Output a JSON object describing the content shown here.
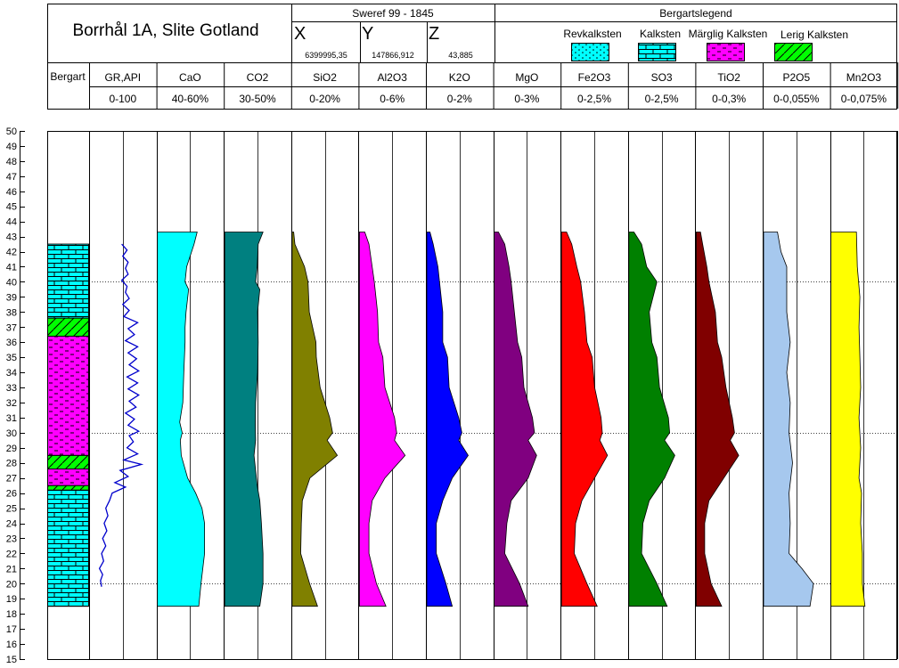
{
  "header": {
    "title": "Borrhål 1A, Slite Gotland",
    "coord_title": "Sweref 99 - 1845",
    "x_label": "X",
    "x_value": "6399995,35",
    "y_label": "Y",
    "y_value": "147866,912",
    "z_label": "Z",
    "z_value": "43,885",
    "legend_title": "Bergartslegend",
    "legend_items": [
      {
        "label": "Revkalksten",
        "color": "#00ffff",
        "pattern": "dots"
      },
      {
        "label": "Kalksten",
        "color": "#00ffff",
        "pattern": "brick"
      },
      {
        "label": "Märglig Kalksten",
        "color": "#ff00ff",
        "pattern": "dash"
      },
      {
        "label": "Lerig Kalksten",
        "color": "#00ff00",
        "pattern": "diag"
      }
    ],
    "bergart_label": "Bergart"
  },
  "chart_data": {
    "type": "area",
    "depth_axis": {
      "min": 15,
      "max": 50,
      "step": 1,
      "ticks": [
        "15",
        "16",
        "17",
        "18",
        "19",
        "20",
        "21",
        "22",
        "23",
        "24",
        "25",
        "26",
        "27",
        "28",
        "29",
        "30",
        "31",
        "32",
        "33",
        "34",
        "35",
        "36",
        "37",
        "38",
        "39",
        "40",
        "41",
        "42",
        "43",
        "44",
        "45",
        "46",
        "47",
        "48",
        "49",
        "50"
      ]
    },
    "reference_lines": [
      20,
      30,
      40
    ],
    "lithology": [
      {
        "from": 18.5,
        "to": 26.2,
        "type": "Kalksten"
      },
      {
        "from": 26.2,
        "to": 26.5,
        "type": "Lerig Kalksten"
      },
      {
        "from": 26.5,
        "to": 27.6,
        "type": "Märglig Kalksten"
      },
      {
        "from": 27.6,
        "to": 28.5,
        "type": "Lerig Kalksten"
      },
      {
        "from": 28.5,
        "to": 36.4,
        "type": "Märglig Kalksten"
      },
      {
        "from": 36.4,
        "to": 37.6,
        "type": "Lerig Kalksten"
      },
      {
        "from": 37.6,
        "to": 42.5,
        "type": "Kalksten"
      }
    ],
    "gamma": {
      "name": "GR,API",
      "range_text": "0-100",
      "min": 0,
      "max": 100,
      "color": "#0000cc",
      "points": [
        [
          19.8,
          10
        ],
        [
          20.2,
          8
        ],
        [
          20.6,
          12
        ],
        [
          21.0,
          6
        ],
        [
          21.5,
          14
        ],
        [
          22.0,
          10
        ],
        [
          22.5,
          18
        ],
        [
          23.0,
          12
        ],
        [
          23.5,
          20
        ],
        [
          24.0,
          15
        ],
        [
          24.5,
          22
        ],
        [
          25.0,
          18
        ],
        [
          25.5,
          25
        ],
        [
          26.0,
          30
        ],
        [
          26.4,
          55
        ],
        [
          26.7,
          35
        ],
        [
          27.1,
          60
        ],
        [
          27.5,
          45
        ],
        [
          27.9,
          85
        ],
        [
          28.2,
          52
        ],
        [
          28.6,
          78
        ],
        [
          29.0,
          58
        ],
        [
          29.4,
          70
        ],
        [
          29.8,
          62
        ],
        [
          30.1,
          80
        ],
        [
          30.5,
          60
        ],
        [
          30.9,
          72
        ],
        [
          31.3,
          55
        ],
        [
          31.7,
          75
        ],
        [
          32.1,
          62
        ],
        [
          32.5,
          80
        ],
        [
          32.9,
          60
        ],
        [
          33.3,
          78
        ],
        [
          33.7,
          58
        ],
        [
          34.1,
          80
        ],
        [
          34.5,
          62
        ],
        [
          34.9,
          76
        ],
        [
          35.3,
          60
        ],
        [
          35.7,
          78
        ],
        [
          36.1,
          55
        ],
        [
          36.5,
          72
        ],
        [
          36.9,
          60
        ],
        [
          37.3,
          78
        ],
        [
          37.7,
          52
        ],
        [
          38.1,
          62
        ],
        [
          38.5,
          50
        ],
        [
          38.9,
          62
        ],
        [
          39.3,
          55
        ],
        [
          39.7,
          58
        ],
        [
          40.1,
          48
        ],
        [
          40.5,
          60
        ],
        [
          40.9,
          55
        ],
        [
          41.3,
          60
        ],
        [
          41.7,
          50
        ],
        [
          42.1,
          58
        ],
        [
          42.5,
          48
        ]
      ]
    },
    "series": [
      {
        "name": "CaO",
        "range_text": "40-60%",
        "min": 40,
        "max": 60,
        "color": "#00ffff",
        "points": [
          [
            18.5,
            53
          ],
          [
            20,
            53.7
          ],
          [
            22,
            54.8
          ],
          [
            24,
            54.8
          ],
          [
            25,
            54
          ],
          [
            26,
            52
          ],
          [
            27,
            49.5
          ],
          [
            28.5,
            47.5
          ],
          [
            29.5,
            47.2
          ],
          [
            30,
            47.8
          ],
          [
            30.7,
            47
          ],
          [
            32,
            48
          ],
          [
            34,
            48.3
          ],
          [
            36,
            48.7
          ],
          [
            37,
            48.7
          ],
          [
            38,
            49
          ],
          [
            39.5,
            49.8
          ],
          [
            40,
            48.7
          ],
          [
            41,
            49.2
          ],
          [
            42.5,
            51.5
          ],
          [
            43.3,
            52.5
          ]
        ]
      },
      {
        "name": "CO2",
        "range_text": "30-50%",
        "min": 30,
        "max": 50,
        "color": "#008080",
        "points": [
          [
            18.5,
            41
          ],
          [
            20,
            42
          ],
          [
            22,
            42
          ],
          [
            24,
            41.5
          ],
          [
            25.5,
            41
          ],
          [
            26.5,
            40.2
          ],
          [
            28.5,
            39.2
          ],
          [
            29.5,
            39.7
          ],
          [
            30.5,
            39.6
          ],
          [
            32,
            39.7
          ],
          [
            34,
            40.3
          ],
          [
            36,
            40.5
          ],
          [
            38,
            40.3
          ],
          [
            39.5,
            41
          ],
          [
            40,
            39.7
          ],
          [
            41,
            40.2
          ],
          [
            42.5,
            40.5
          ],
          [
            43.3,
            42
          ]
        ]
      },
      {
        "name": "SiO2",
        "range_text": "0-20%",
        "min": 0,
        "max": 20,
        "color": "#808000",
        "points": [
          [
            18.5,
            8
          ],
          [
            20,
            5.5
          ],
          [
            22,
            2.7
          ],
          [
            24,
            2.9
          ],
          [
            25.5,
            3.2
          ],
          [
            27,
            5.6
          ],
          [
            28.5,
            14.2
          ],
          [
            29.5,
            11
          ],
          [
            30,
            12.7
          ],
          [
            31,
            11.8
          ],
          [
            33,
            8.8
          ],
          [
            35,
            7.6
          ],
          [
            36,
            7.5
          ],
          [
            38,
            5.4
          ],
          [
            40,
            5
          ],
          [
            41,
            3.9
          ],
          [
            42.5,
            0.9
          ],
          [
            43.3,
            0.5
          ]
        ]
      },
      {
        "name": "Al2O3",
        "range_text": "0-6%",
        "min": 0,
        "max": 6,
        "color": "#ff00ff",
        "points": [
          [
            18.5,
            2.5
          ],
          [
            20,
            1.6
          ],
          [
            22,
            0.9
          ],
          [
            24,
            0.9
          ],
          [
            25.5,
            1.2
          ],
          [
            27,
            2.4
          ],
          [
            28.5,
            4.3
          ],
          [
            29.5,
            3.3
          ],
          [
            30,
            3.5
          ],
          [
            31,
            3.3
          ],
          [
            33,
            2.4
          ],
          [
            35,
            2.2
          ],
          [
            36,
            1.8
          ],
          [
            38,
            1.7
          ],
          [
            40,
            1.4
          ],
          [
            41,
            1.2
          ],
          [
            42.5,
            0.9
          ],
          [
            43.3,
            0.5
          ]
        ]
      },
      {
        "name": "K2O",
        "range_text": "0-2%",
        "min": 0,
        "max": 2,
        "color": "#0000ff",
        "points": [
          [
            18.5,
            0.8
          ],
          [
            20,
            0.6
          ],
          [
            22,
            0.3
          ],
          [
            24,
            0.3
          ],
          [
            25.5,
            0.5
          ],
          [
            27,
            0.8
          ],
          [
            28.5,
            1.3
          ],
          [
            29.5,
            1.0
          ],
          [
            30,
            1.1
          ],
          [
            31,
            1.0
          ],
          [
            33,
            0.7
          ],
          [
            35,
            0.65
          ],
          [
            36,
            0.5
          ],
          [
            38,
            0.5
          ],
          [
            40,
            0.4
          ],
          [
            41,
            0.35
          ],
          [
            42.5,
            0.2
          ],
          [
            43.3,
            0.1
          ]
        ]
      },
      {
        "name": "MgO",
        "range_text": "0-3%",
        "min": 0,
        "max": 3,
        "color": "#800080",
        "points": [
          [
            18.5,
            1.6
          ],
          [
            20,
            1.2
          ],
          [
            22,
            0.5
          ],
          [
            24,
            0.6
          ],
          [
            25.5,
            0.8
          ],
          [
            27,
            1.6
          ],
          [
            28.5,
            2.0
          ],
          [
            29.5,
            1.6
          ],
          [
            30,
            1.9
          ],
          [
            31,
            1.8
          ],
          [
            33,
            1.4
          ],
          [
            35,
            1.3
          ],
          [
            36,
            1.1
          ],
          [
            38,
            0.95
          ],
          [
            40,
            0.8
          ],
          [
            41,
            0.7
          ],
          [
            42.5,
            0.5
          ],
          [
            43.3,
            0.2
          ]
        ]
      },
      {
        "name": "Fe2O3",
        "range_text": "0-2,5%",
        "min": 0,
        "max": 2.5,
        "color": "#ff0000",
        "points": [
          [
            18.5,
            1.4
          ],
          [
            20,
            1.0
          ],
          [
            22,
            0.5
          ],
          [
            24,
            0.55
          ],
          [
            25.5,
            0.8
          ],
          [
            27,
            1.3
          ],
          [
            28.5,
            1.8
          ],
          [
            29.5,
            1.5
          ],
          [
            30,
            1.6
          ],
          [
            31,
            1.55
          ],
          [
            33,
            1.3
          ],
          [
            35,
            1.2
          ],
          [
            36,
            1.0
          ],
          [
            38,
            0.9
          ],
          [
            40,
            0.75
          ],
          [
            41,
            0.6
          ],
          [
            42.5,
            0.4
          ],
          [
            43.3,
            0.2
          ]
        ]
      },
      {
        "name": "SO3",
        "range_text": "0-2,5%",
        "min": 0,
        "max": 2.5,
        "color": "#008000",
        "points": [
          [
            18.5,
            1.5
          ],
          [
            20,
            1.1
          ],
          [
            22,
            0.5
          ],
          [
            24,
            0.55
          ],
          [
            25.5,
            0.8
          ],
          [
            27,
            1.4
          ],
          [
            28.5,
            1.8
          ],
          [
            29.5,
            1.4
          ],
          [
            30,
            1.6
          ],
          [
            31,
            1.55
          ],
          [
            33,
            1.2
          ],
          [
            35,
            1.1
          ],
          [
            36,
            0.9
          ],
          [
            38,
            0.8
          ],
          [
            40,
            1.1
          ],
          [
            41,
            0.7
          ],
          [
            42.5,
            0.5
          ],
          [
            43.3,
            0.2
          ]
        ]
      },
      {
        "name": "TiO2",
        "range_text": "0-0,3%",
        "min": 0,
        "max": 0.3,
        "color": "#800000",
        "points": [
          [
            18.5,
            0.12
          ],
          [
            20,
            0.07
          ],
          [
            22,
            0.04
          ],
          [
            24,
            0.04
          ],
          [
            25.5,
            0.06
          ],
          [
            27,
            0.13
          ],
          [
            28.5,
            0.2
          ],
          [
            29.5,
            0.16
          ],
          [
            30,
            0.18
          ],
          [
            31,
            0.17
          ],
          [
            33,
            0.14
          ],
          [
            35,
            0.12
          ],
          [
            36,
            0.1
          ],
          [
            38,
            0.09
          ],
          [
            40,
            0.06
          ],
          [
            41,
            0.05
          ],
          [
            42.5,
            0.03
          ],
          [
            43.3,
            0.02
          ]
        ]
      },
      {
        "name": "P2O5",
        "range_text": "0-0,055%",
        "min": 0,
        "max": 0.055,
        "color": "#a6c8ee",
        "points": [
          [
            18.5,
            0.04
          ],
          [
            20,
            0.043
          ],
          [
            21,
            0.033
          ],
          [
            22,
            0.022
          ],
          [
            24,
            0.023
          ],
          [
            26,
            0.022
          ],
          [
            28,
            0.025
          ],
          [
            30,
            0.022
          ],
          [
            32,
            0.023
          ],
          [
            34,
            0.02
          ],
          [
            36,
            0.023
          ],
          [
            38,
            0.02
          ],
          [
            40,
            0.02
          ],
          [
            41,
            0.02
          ],
          [
            42,
            0.015
          ],
          [
            43.3,
            0.012
          ]
        ]
      },
      {
        "name": "Mn2O3",
        "range_text": "0-0,075%",
        "min": 0,
        "max": 0.075,
        "color": "#ffff00",
        "points": [
          [
            18.5,
            0.04
          ],
          [
            20,
            0.037
          ],
          [
            22,
            0.037
          ],
          [
            24,
            0.035
          ],
          [
            26,
            0.036
          ],
          [
            27,
            0.033
          ],
          [
            29,
            0.035
          ],
          [
            31,
            0.033
          ],
          [
            33,
            0.035
          ],
          [
            35,
            0.034
          ],
          [
            37,
            0.033
          ],
          [
            39,
            0.034
          ],
          [
            41,
            0.031
          ],
          [
            43.3,
            0.03
          ]
        ]
      }
    ]
  }
}
